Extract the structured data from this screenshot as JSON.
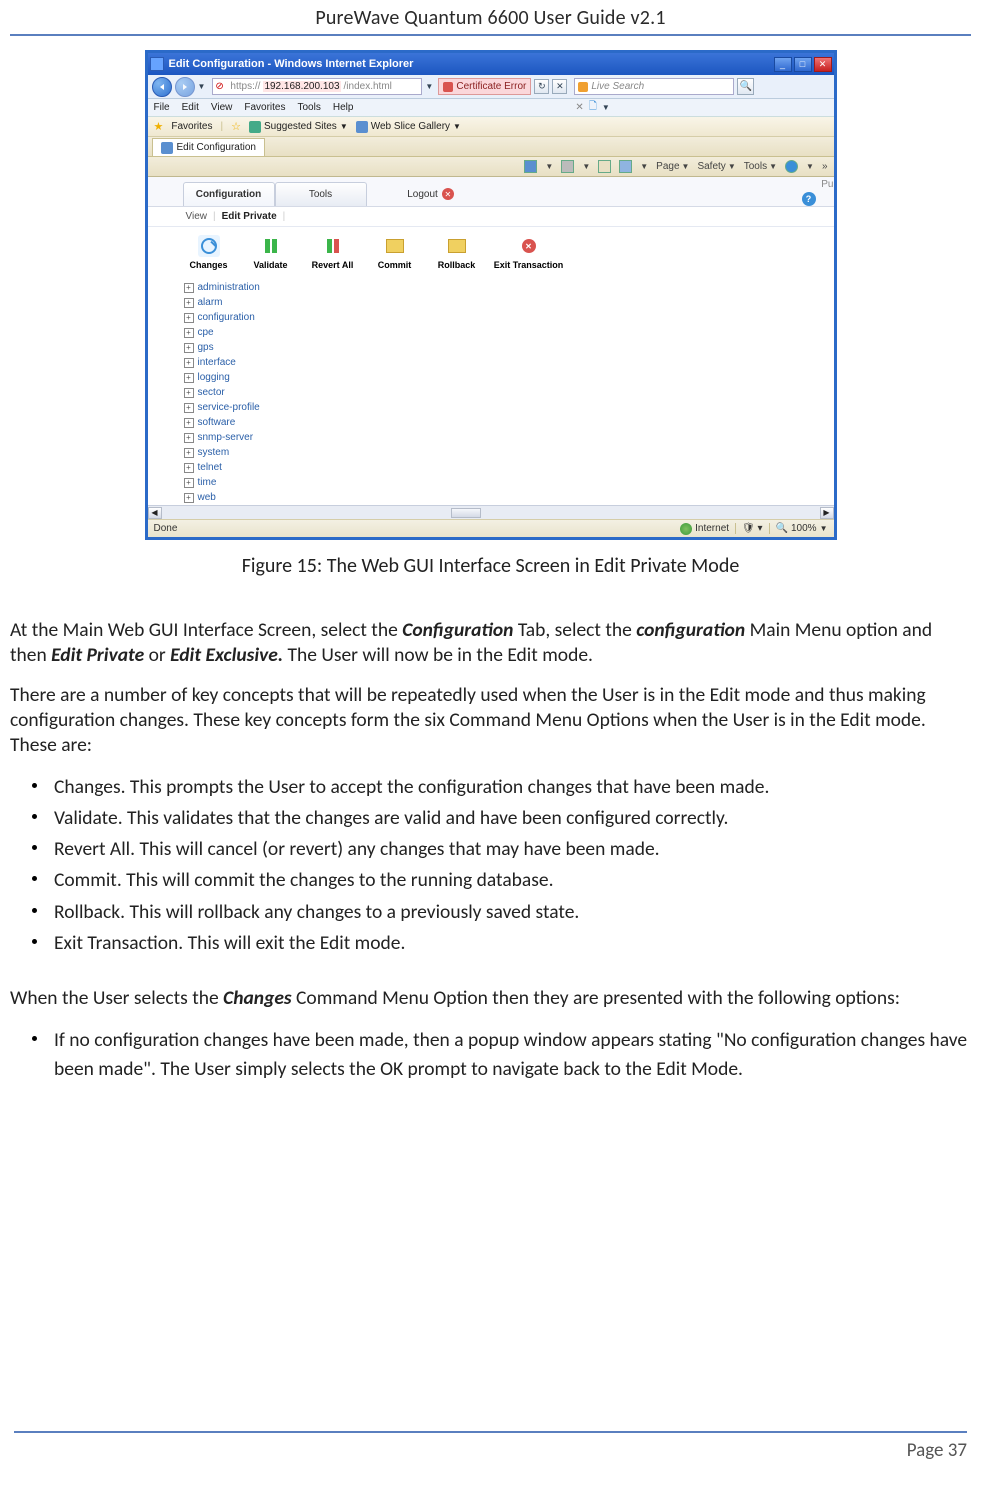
{
  "header": {
    "title": "PureWave Quantum 6600 User Guide v2.1"
  },
  "ie_window": {
    "title": "Edit Configuration - Windows Internet Explorer",
    "url_proto": "https://",
    "url_host": "192.168.200.103",
    "url_path": "/index.html",
    "cert_error": "Certificate Error",
    "search_placeholder": "Live Search",
    "menu": [
      "File",
      "Edit",
      "View",
      "Favorites",
      "Tools",
      "Help"
    ],
    "fav_label": "Favorites",
    "suggested_sites": "Suggested Sites",
    "web_slice": "Web Slice Gallery",
    "tab_title": "Edit Configuration",
    "cmdbar": {
      "page": "Page",
      "safety": "Safety",
      "tools": "Tools"
    },
    "status_left": "Done",
    "status_zone": "Internet",
    "status_zoom": "100%"
  },
  "app": {
    "tabs": {
      "config": "Configuration",
      "tools": "Tools",
      "logout": "Logout",
      "brand": "Pu"
    },
    "subtabs": {
      "view": "View",
      "edit_private": "Edit Private"
    },
    "toolbar": {
      "changes": "Changes",
      "validate": "Validate",
      "revert": "Revert All",
      "commit": "Commit",
      "rollback": "Rollback",
      "exit": "Exit Transaction"
    },
    "tree": [
      "administration",
      "alarm",
      "configuration",
      "cpe",
      "gps",
      "interface",
      "logging",
      "sector",
      "service-profile",
      "software",
      "snmp-server",
      "system",
      "telnet",
      "time",
      "web"
    ]
  },
  "caption": "Figure 15: The Web GUI Interface Screen in Edit Private Mode",
  "body": {
    "p1a": "At the Main Web GUI Interface Screen, select the ",
    "p1b": "Configuration",
    "p1c": " Tab, select the ",
    "p1d": "configuration",
    "p1e": " Main Menu option and then ",
    "p1f": "Edit Private",
    "p1g": " or ",
    "p1h": "Edit Exclusive.",
    "p1i": " The User will now be in the Edit mode.",
    "p2": "There are a number of key concepts that will be repeatedly used when the User is in the Edit mode and thus making configuration changes. These key concepts form the six Command Menu Options when the User is in the Edit mode. These are:",
    "li1a": "Changes.",
    "li1b": " This prompts the User to accept the configuration changes that have been made.",
    "li2a": "Validate.",
    "li2b": " This validates that the changes are valid and have been configured correctly.",
    "li3a": "Revert All.",
    "li3b": " This will cancel (or revert) any changes that may have been made.",
    "li4a": "Commit.",
    "li4b": " This will commit the changes to the running database.",
    "li5a": "Rollback.",
    "li5b": " This will rollback any changes to a previously saved state.",
    "li6a": "Exit Transaction.",
    "li6b": " This will exit the Edit mode.",
    "p3a": "When the User selects the ",
    "p3b": "Changes",
    "p3c": " Command Menu Option then they are presented with the following options:",
    "li7a": "If no configuration changes have been made, then a popup window appears stating \"No configuration changes have been made\". The User simply selects the ",
    "li7b": "OK",
    "li7c": " prompt to navigate back to the Edit Mode."
  },
  "footer": {
    "page": "Page 37"
  }
}
